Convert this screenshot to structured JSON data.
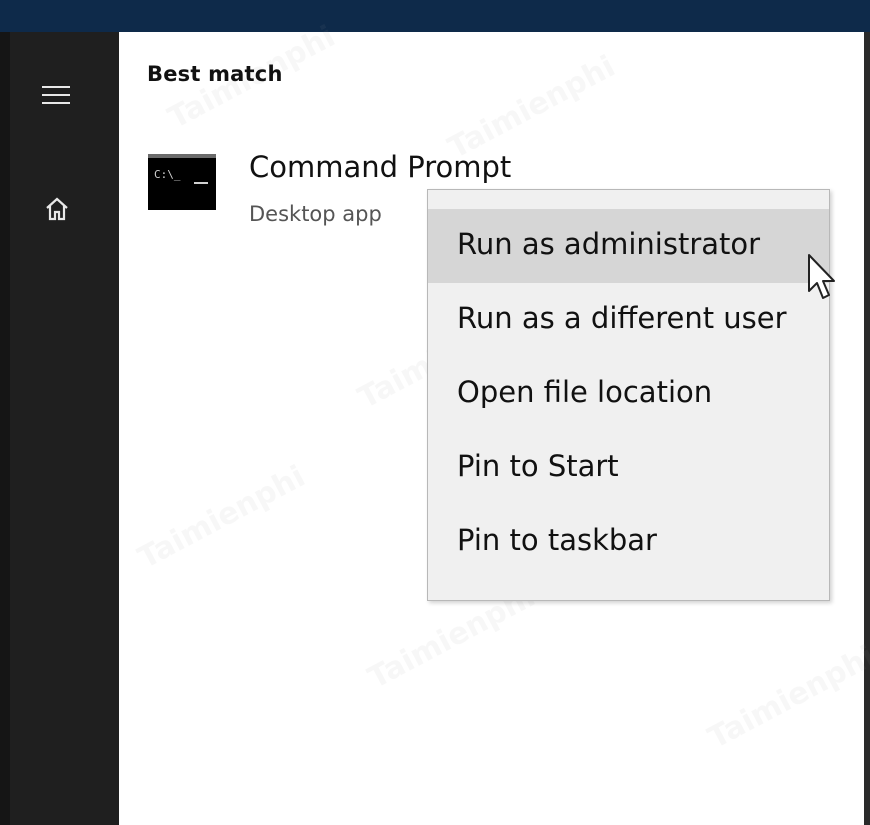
{
  "search": {
    "section_label": "Best match",
    "result": {
      "title": "Command Prompt",
      "subtitle": "Desktop app",
      "icon": "command-prompt-icon",
      "icon_prompt_text": "C:\\_"
    }
  },
  "context_menu": {
    "items": [
      {
        "label": "Run as administrator",
        "highlighted": true
      },
      {
        "label": "Run as a different user",
        "highlighted": false
      },
      {
        "label": "Open file location",
        "highlighted": false
      },
      {
        "label": "Pin to Start",
        "highlighted": false
      },
      {
        "label": "Pin to taskbar",
        "highlighted": false
      }
    ]
  },
  "nav_rail": {
    "icons": [
      "hamburger-menu-icon",
      "home-icon"
    ]
  },
  "watermark_text": "Taimienphi",
  "colors": {
    "top_border": "#0e2a4a",
    "rail_background": "#1f1f1f",
    "panel_background": "#ffffff",
    "menu_background": "#f0f0f0",
    "menu_highlight": "#d6d6d6"
  }
}
